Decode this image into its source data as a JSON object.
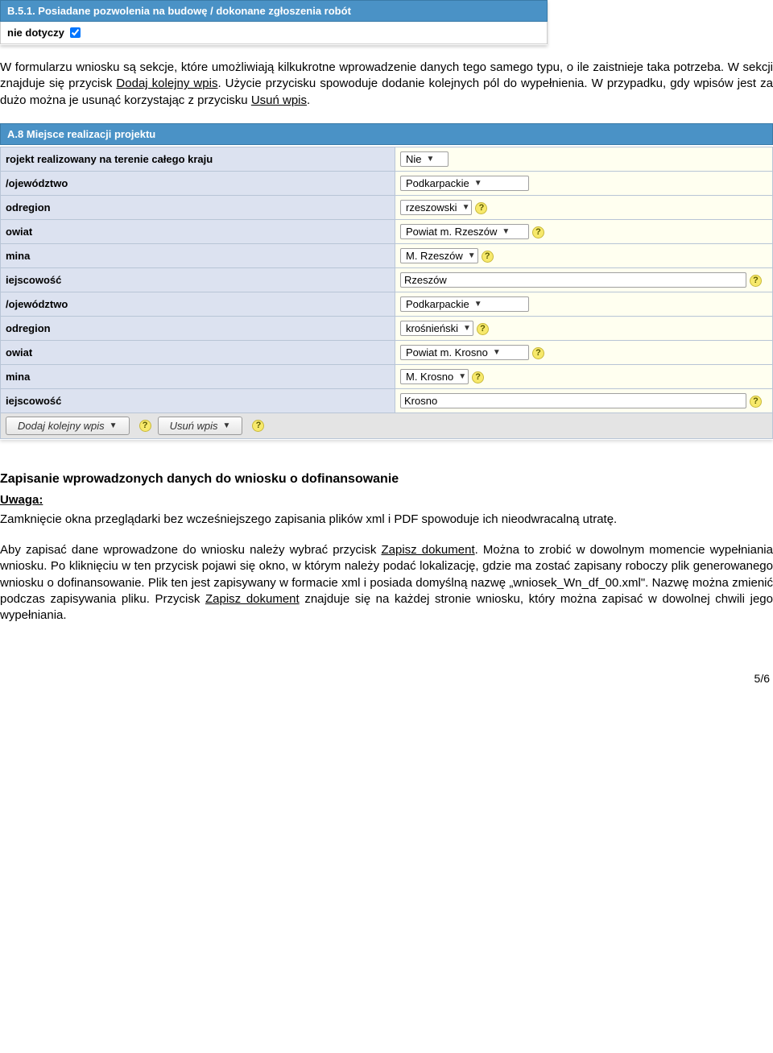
{
  "top_section": {
    "header": "B.5.1. Posiadane pozwolenia na budowę / dokonane zgłoszenia robót",
    "nie_dotyczy": "nie dotyczy"
  },
  "para1": {
    "t1": "W formularzu wniosku są sekcje, które umożliwiają kilkukrotne wprowadzenie danych tego samego typu, o ile zaistnieje taka potrzeba. W sekcji znajduje się przycisk ",
    "u1": "Dodaj kolejny wpis",
    "t2": ". Użycie przycisku spowoduje dodanie kolejnych pól do wypełnienia. W przypadku, gdy wpisów jest za dużo można je usunąć korzystając z przycisku ",
    "u2": "Usuń wpis",
    "t3": "."
  },
  "sectionA8": {
    "header": "A.8 Miejsce realizacji projektu",
    "rows1": [
      {
        "label": "rojekt realizowany na terenie całego kraju",
        "type": "select",
        "value": "Nie",
        "help": false
      },
      {
        "label": "/ojewództwo",
        "type": "select",
        "value": "Podkarpackie",
        "help": false,
        "wide": true
      },
      {
        "label": "odregion",
        "type": "select",
        "value": "rzeszowski",
        "help": true
      },
      {
        "label": "owiat",
        "type": "select",
        "value": "Powiat m. Rzeszów",
        "help": true,
        "wide": true
      },
      {
        "label": "mina",
        "type": "select",
        "value": "M. Rzeszów",
        "help": true
      },
      {
        "label": "iejscowość",
        "type": "text",
        "value": "Rzeszów",
        "help": true
      }
    ],
    "rows2": [
      {
        "label": "/ojewództwo",
        "type": "select",
        "value": "Podkarpackie",
        "help": false,
        "wide": true
      },
      {
        "label": "odregion",
        "type": "select",
        "value": "krośnieński",
        "help": true
      },
      {
        "label": "owiat",
        "type": "select",
        "value": "Powiat m. Krosno",
        "help": true,
        "wide": true
      },
      {
        "label": "mina",
        "type": "select",
        "value": "M. Krosno",
        "help": true
      },
      {
        "label": "iejscowość",
        "type": "text",
        "value": "Krosno",
        "help": true
      }
    ],
    "btn_add": "Dodaj kolejny wpis",
    "btn_del": "Usuń wpis"
  },
  "heading2": "Zapisanie wprowadzonych danych do wniosku o dofinansowanie",
  "heading3": "Uwaga:",
  "para2": "Zamknięcie okna przeglądarki bez wcześniejszego zapisania plików xml i PDF spowoduje ich nieodwracalną utratę.",
  "para3": {
    "t1": "Aby zapisać dane wprowadzone do wniosku należy wybrać przycisk ",
    "u1": "Zapisz dokument",
    "t2": ". Można to zrobić w dowolnym momencie wypełniania wniosku. Po kliknięciu w ten przycisk pojawi się okno, w którym należy podać lokalizację, gdzie ma zostać zapisany roboczy plik generowanego wniosku o dofinansowanie. Plik ten jest zapisywany w formacie xml i posiada domyślną nazwę „wniosek_Wn_df_00.xml\". Nazwę można zmienić podczas zapisywania pliku. Przycisk ",
    "u2": "Zapisz dokument",
    "t3": " znajduje się na każdej stronie wniosku, który można zapisać w dowolnej chwili jego wypełniania."
  },
  "page_num": "5/6"
}
